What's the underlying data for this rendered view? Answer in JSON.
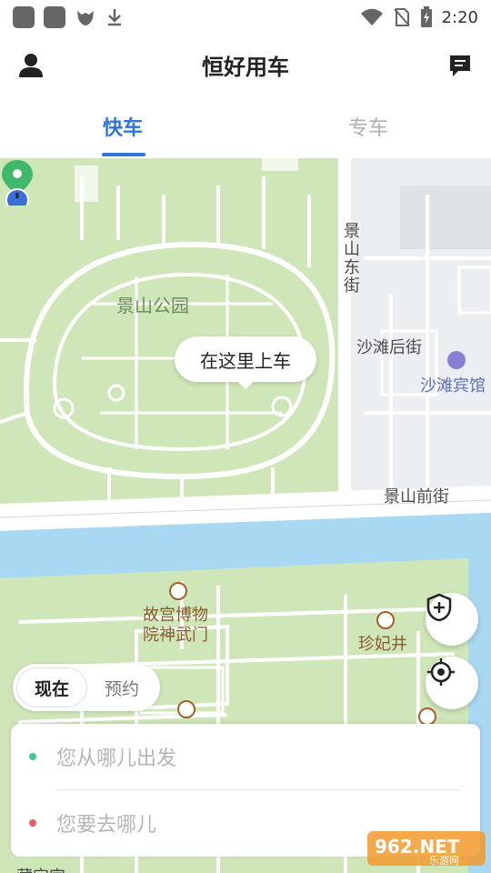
{
  "status_bar": {
    "time": "2:20",
    "icons": [
      "app-icon",
      "app-icon",
      "fox-icon",
      "download-icon",
      "wifi-icon",
      "no-sim-icon",
      "battery-charging-icon"
    ]
  },
  "header": {
    "title": "恒好用车",
    "left_icon": "user-icon",
    "right_icon": "message-icon"
  },
  "tabs": [
    {
      "label": "快车",
      "active": true
    },
    {
      "label": "专车",
      "active": false
    }
  ],
  "map": {
    "labels": {
      "park": "景山公园",
      "jingshan_east_st": "景山东街",
      "shatan_hou_st": "沙滩后街",
      "shatan_hotel": "沙滩宾馆",
      "jingshan_front_st": "景山前街",
      "museum_gate_line1": "故宫博物",
      "museum_gate_line2": "院神武门",
      "zhenfei_well": "珍妃井",
      "bottom_fragment": "藏宝宫"
    },
    "pickup_bubble": "在这里上车",
    "colors": {
      "park_green": "#cfe7b8",
      "water": "#a9d8f2",
      "road": "#ffffff",
      "pin_green": "#3fb86b",
      "location_blue": "#3a6fd8"
    }
  },
  "map_controls": {
    "safety_icon": "shield-plus-icon",
    "locate_icon": "crosshair-locate-icon"
  },
  "time_toggle": {
    "now": "现在",
    "reserve": "预约"
  },
  "address": {
    "from_placeholder": "您从哪儿出发",
    "to_placeholder": "您要去哪儿",
    "from_dot_color": "#3cc99a",
    "to_dot_color": "#e85e6b"
  },
  "watermark": {
    "brand": "962.NET",
    "sub": "乐游网"
  }
}
